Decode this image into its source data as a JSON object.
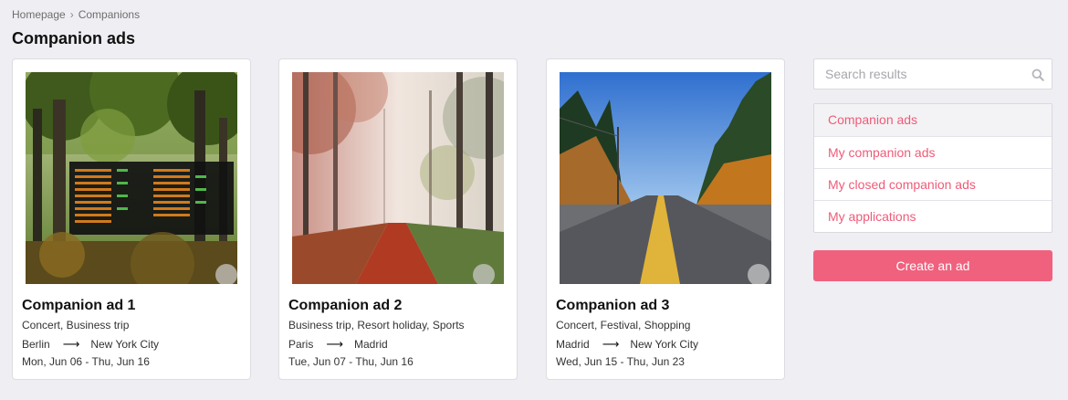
{
  "breadcrumb": {
    "items": [
      "Homepage",
      "Companions"
    ],
    "separator": "›"
  },
  "page_title": "Companion ads",
  "cards": [
    {
      "title": "Companion ad 1",
      "tags": "Concert, Business trip",
      "from": "Berlin",
      "to": "New York City",
      "dates": "Mon, Jun 06 - Thu, Jun 16",
      "image": "forest-with-departure-board"
    },
    {
      "title": "Companion ad 2",
      "tags": "Business trip, Resort holiday, Sports",
      "from": "Paris",
      "to": "Madrid",
      "dates": "Tue, Jun 07 - Thu, Jun 16",
      "image": "misty-autumn-forest-path"
    },
    {
      "title": "Companion ad 3",
      "tags": "Concert, Festival, Shopping",
      "from": "Madrid",
      "to": "New York City",
      "dates": "Wed, Jun 15 - Thu, Jun 23",
      "image": "road-through-autumn-trees"
    }
  ],
  "route_arrow": "⟶",
  "search": {
    "placeholder": "Search results",
    "icon": "search-icon"
  },
  "menu": {
    "items": [
      {
        "label": "Companion ads"
      },
      {
        "label": "My companion ads"
      },
      {
        "label": "My closed companion ads"
      },
      {
        "label": "My applications"
      }
    ]
  },
  "create_button": {
    "label": "Create an ad"
  },
  "colors": {
    "accent": "#f0617e",
    "link": "#ef5b78",
    "background": "#efeef3"
  }
}
